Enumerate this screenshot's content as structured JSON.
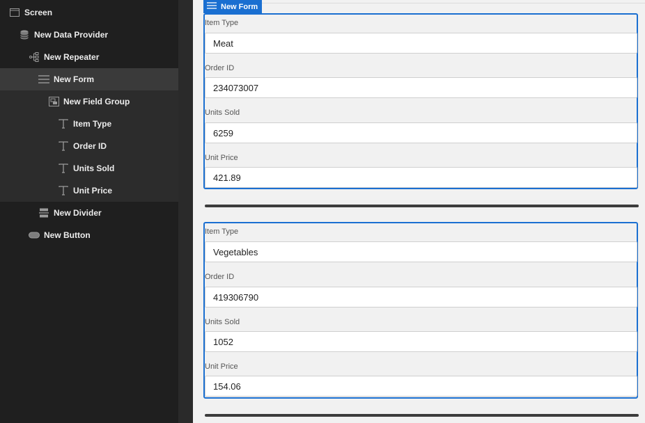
{
  "sidebar": {
    "items": [
      {
        "label": "Screen",
        "icon": "screen-icon"
      },
      {
        "label": "New Data Provider",
        "icon": "database-icon"
      },
      {
        "label": "New Repeater",
        "icon": "repeater-icon"
      },
      {
        "label": "New Form",
        "icon": "form-icon"
      },
      {
        "label": "New Field Group",
        "icon": "field-group-icon"
      },
      {
        "label": "Item Type",
        "icon": "text-field-icon"
      },
      {
        "label": "Order ID",
        "icon": "text-field-icon"
      },
      {
        "label": "Units Sold",
        "icon": "text-field-icon"
      },
      {
        "label": "Unit Price",
        "icon": "text-field-icon"
      },
      {
        "label": "New Divider",
        "icon": "divider-icon"
      },
      {
        "label": "New Button",
        "icon": "button-icon"
      }
    ]
  },
  "canvas": {
    "form_tag": "New Form",
    "forms": [
      {
        "fields": [
          {
            "label": "Item Type",
            "value": "Meat"
          },
          {
            "label": "Order ID",
            "value": "234073007"
          },
          {
            "label": "Units Sold",
            "value": "6259"
          },
          {
            "label": "Unit Price",
            "value": "421.89"
          }
        ]
      },
      {
        "fields": [
          {
            "label": "Item Type",
            "value": "Vegetables"
          },
          {
            "label": "Order ID",
            "value": "419306790"
          },
          {
            "label": "Units Sold",
            "value": "1052"
          },
          {
            "label": "Unit Price",
            "value": "154.06"
          }
        ]
      }
    ]
  },
  "colors": {
    "accent": "#1a6fd1",
    "sidebar_bg": "#1f1f1f",
    "selected_bg": "#3a3a3a"
  }
}
